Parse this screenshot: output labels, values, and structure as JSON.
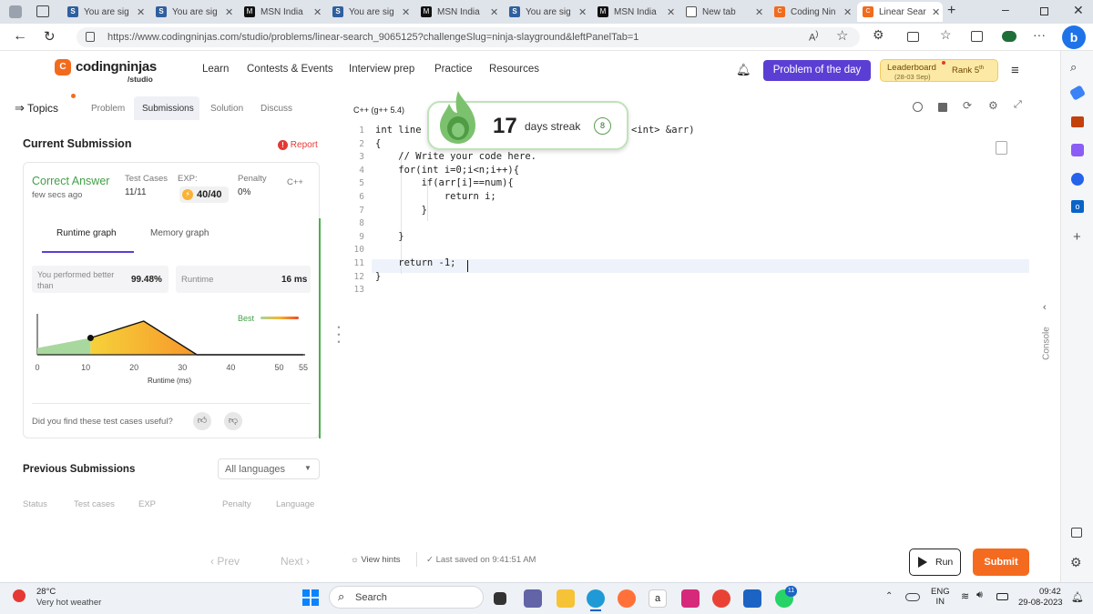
{
  "browser": {
    "tabs": [
      {
        "label": "You are sig",
        "icon": "s-icon"
      },
      {
        "label": "You are sig",
        "icon": "s-icon"
      },
      {
        "label": "MSN India",
        "icon": "msn-icon"
      },
      {
        "label": "You are sig",
        "icon": "s-icon"
      },
      {
        "label": "MSN India",
        "icon": "msn-icon"
      },
      {
        "label": "You are sig",
        "icon": "s-icon"
      },
      {
        "label": "MSN India",
        "icon": "msn-icon"
      },
      {
        "label": "New tab",
        "icon": "newtab-icon"
      },
      {
        "label": "Coding Nin",
        "icon": "codingninjas-icon"
      },
      {
        "label": "Linear Sear",
        "icon": "codingninjas-icon",
        "active": true
      }
    ],
    "url": "https://www.codingninjas.com/studio/problems/linear-search_9065125?challengeSlug=ninja-slayground&leftPanelTab=1"
  },
  "header": {
    "logo_main": "codingninjas",
    "logo_sub": "/studio",
    "nav": [
      "Learn",
      "Contests & Events",
      "Interview prep",
      "Practice",
      "Resources"
    ],
    "potd": "Problem of the day",
    "leaderboard": "Leaderboard",
    "leaderboard_date": "(28-03 Sep)",
    "rank": "Rank 5",
    "rank_sup": "th"
  },
  "left": {
    "topics": "Topics",
    "tabs": [
      "Problem",
      "Submissions",
      "Solution",
      "Discuss"
    ],
    "active_tab": "Submissions",
    "current_submission": "Current Submission",
    "report": "Report",
    "result": "Correct Answer",
    "time_ago": "few secs ago",
    "test_cases_label": "Test Cases",
    "test_cases_value": "11/11",
    "exp_label": "EXP:",
    "exp_value": "40/40",
    "penalty_label": "Penalty",
    "penalty_value": "0%",
    "language": "C++",
    "graph_tabs": [
      "Runtime graph",
      "Memory graph"
    ],
    "better_label": "You performed better than",
    "better_value": "99.48%",
    "runtime_label": "Runtime",
    "runtime_value": "16 ms",
    "best_label": "Best",
    "useful_q": "Did you find these test cases useful?",
    "previous": "Previous Submissions",
    "lang_select": "All languages",
    "prev_cols": [
      "Status",
      "Test cases",
      "EXP",
      "Penalty",
      "Language"
    ],
    "prev": "‹ Prev",
    "next": "Next ›"
  },
  "chart_data": {
    "type": "area",
    "xlabel": "Runtime (ms)",
    "x_ticks": [
      "0",
      "10",
      "20",
      "30",
      "40",
      "50",
      "55"
    ],
    "xlim": [
      0,
      55
    ],
    "series": [
      {
        "x": [
          0,
          11,
          22,
          33,
          55
        ],
        "y": [
          0.2,
          0.5,
          1.0,
          0.0,
          0.0
        ]
      }
    ],
    "marker_x": 11,
    "legend": "Best"
  },
  "editor": {
    "compiler": "C++ (g++ 5.4)",
    "lines": [
      "int line",
      "{",
      "    // Write your code here.",
      "    for(int i=0;i<n;i++){",
      "        if(arr[i]==num){",
      "            return i;",
      "        }",
      "",
      "    }",
      "",
      "    return -1;",
      "}",
      ""
    ],
    "line1_tail": "<int> &arr)",
    "streak_number": "17",
    "streak_text": "days streak",
    "streak_badge": "8",
    "view_hints": "View hints",
    "last_saved": "Last saved on 9:41:51 AM",
    "run": "Run",
    "submit": "Submit",
    "console": "Console"
  },
  "taskbar": {
    "temp": "28°C",
    "weather": "Very hot weather",
    "search": "Search",
    "lang": "ENG",
    "region": "IN",
    "time": "09:42",
    "date": "29-08-2023",
    "whatsapp_badge": "11"
  },
  "colors": {
    "accent_purple": "#5b3fd4",
    "orange": "#f46b20",
    "green": "#43a047"
  }
}
